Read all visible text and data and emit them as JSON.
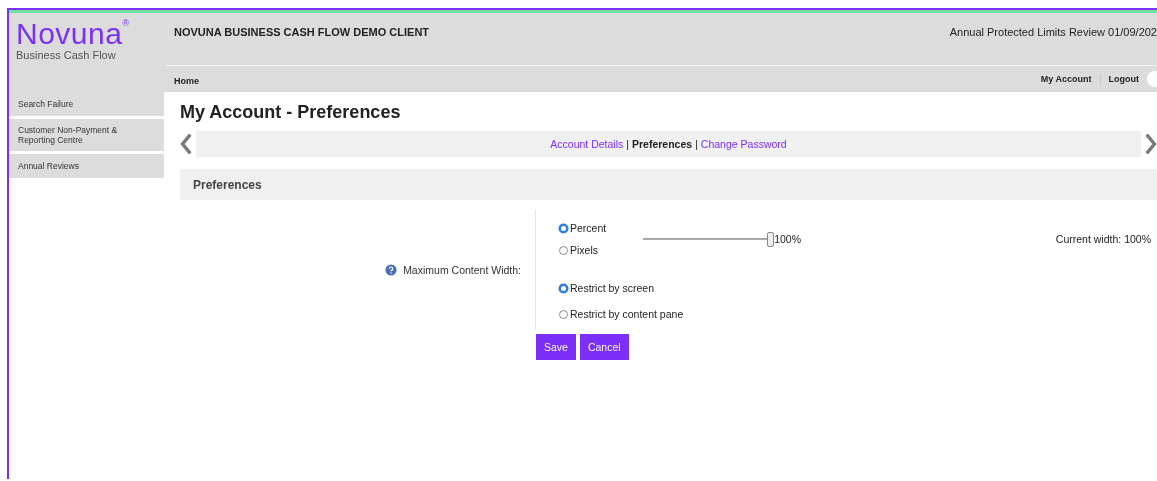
{
  "logo": {
    "name": "Novuna$^{®}$",
    "tagline": "Business Cash Flow"
  },
  "header": {
    "client": "NOVUNA BUSINESS CASH FLOW DEMO CLIENT",
    "notice": "Annual Protected Limits Review 01/09/202"
  },
  "nav": {
    "left": [
      "Home"
    ],
    "right": [
      "My Account",
      "Logout"
    ]
  },
  "sidebar": {
    "items": [
      {
        "label": "Search Failure",
        "selected": false
      },
      {
        "label": "Customer Non-Payment & Reporting Centre",
        "selected": false
      },
      {
        "label": "Annual Reviews",
        "selected": false
      }
    ]
  },
  "page_title": "My Account - Preferences",
  "subnav": [
    {
      "kind": "link",
      "label": "Account Details",
      "selected": false
    },
    {
      "kind": "separator",
      "label": "|"
    },
    {
      "kind": "link",
      "label": "Preferences",
      "selected": true
    },
    {
      "kind": "separator",
      "label": "|"
    },
    {
      "kind": "link",
      "label": "Change Password",
      "selected": false
    }
  ],
  "section_title": "Preferences",
  "setting": {
    "label": "Maximum Content Width:",
    "units": [
      {
        "label": "Percent",
        "selected": true
      },
      {
        "label": "Pixels",
        "selected": false
      }
    ],
    "slider": {
      "level": 1.0,
      "reading": "100%"
    },
    "current": "Current width: 100%",
    "restrict": [
      {
        "label": "Restrict by screen",
        "selected": true
      },
      {
        "label": "Restrict by content pane",
        "selected": false
      }
    ]
  },
  "buttons": [
    "Save",
    "Cancel"
  ]
}
